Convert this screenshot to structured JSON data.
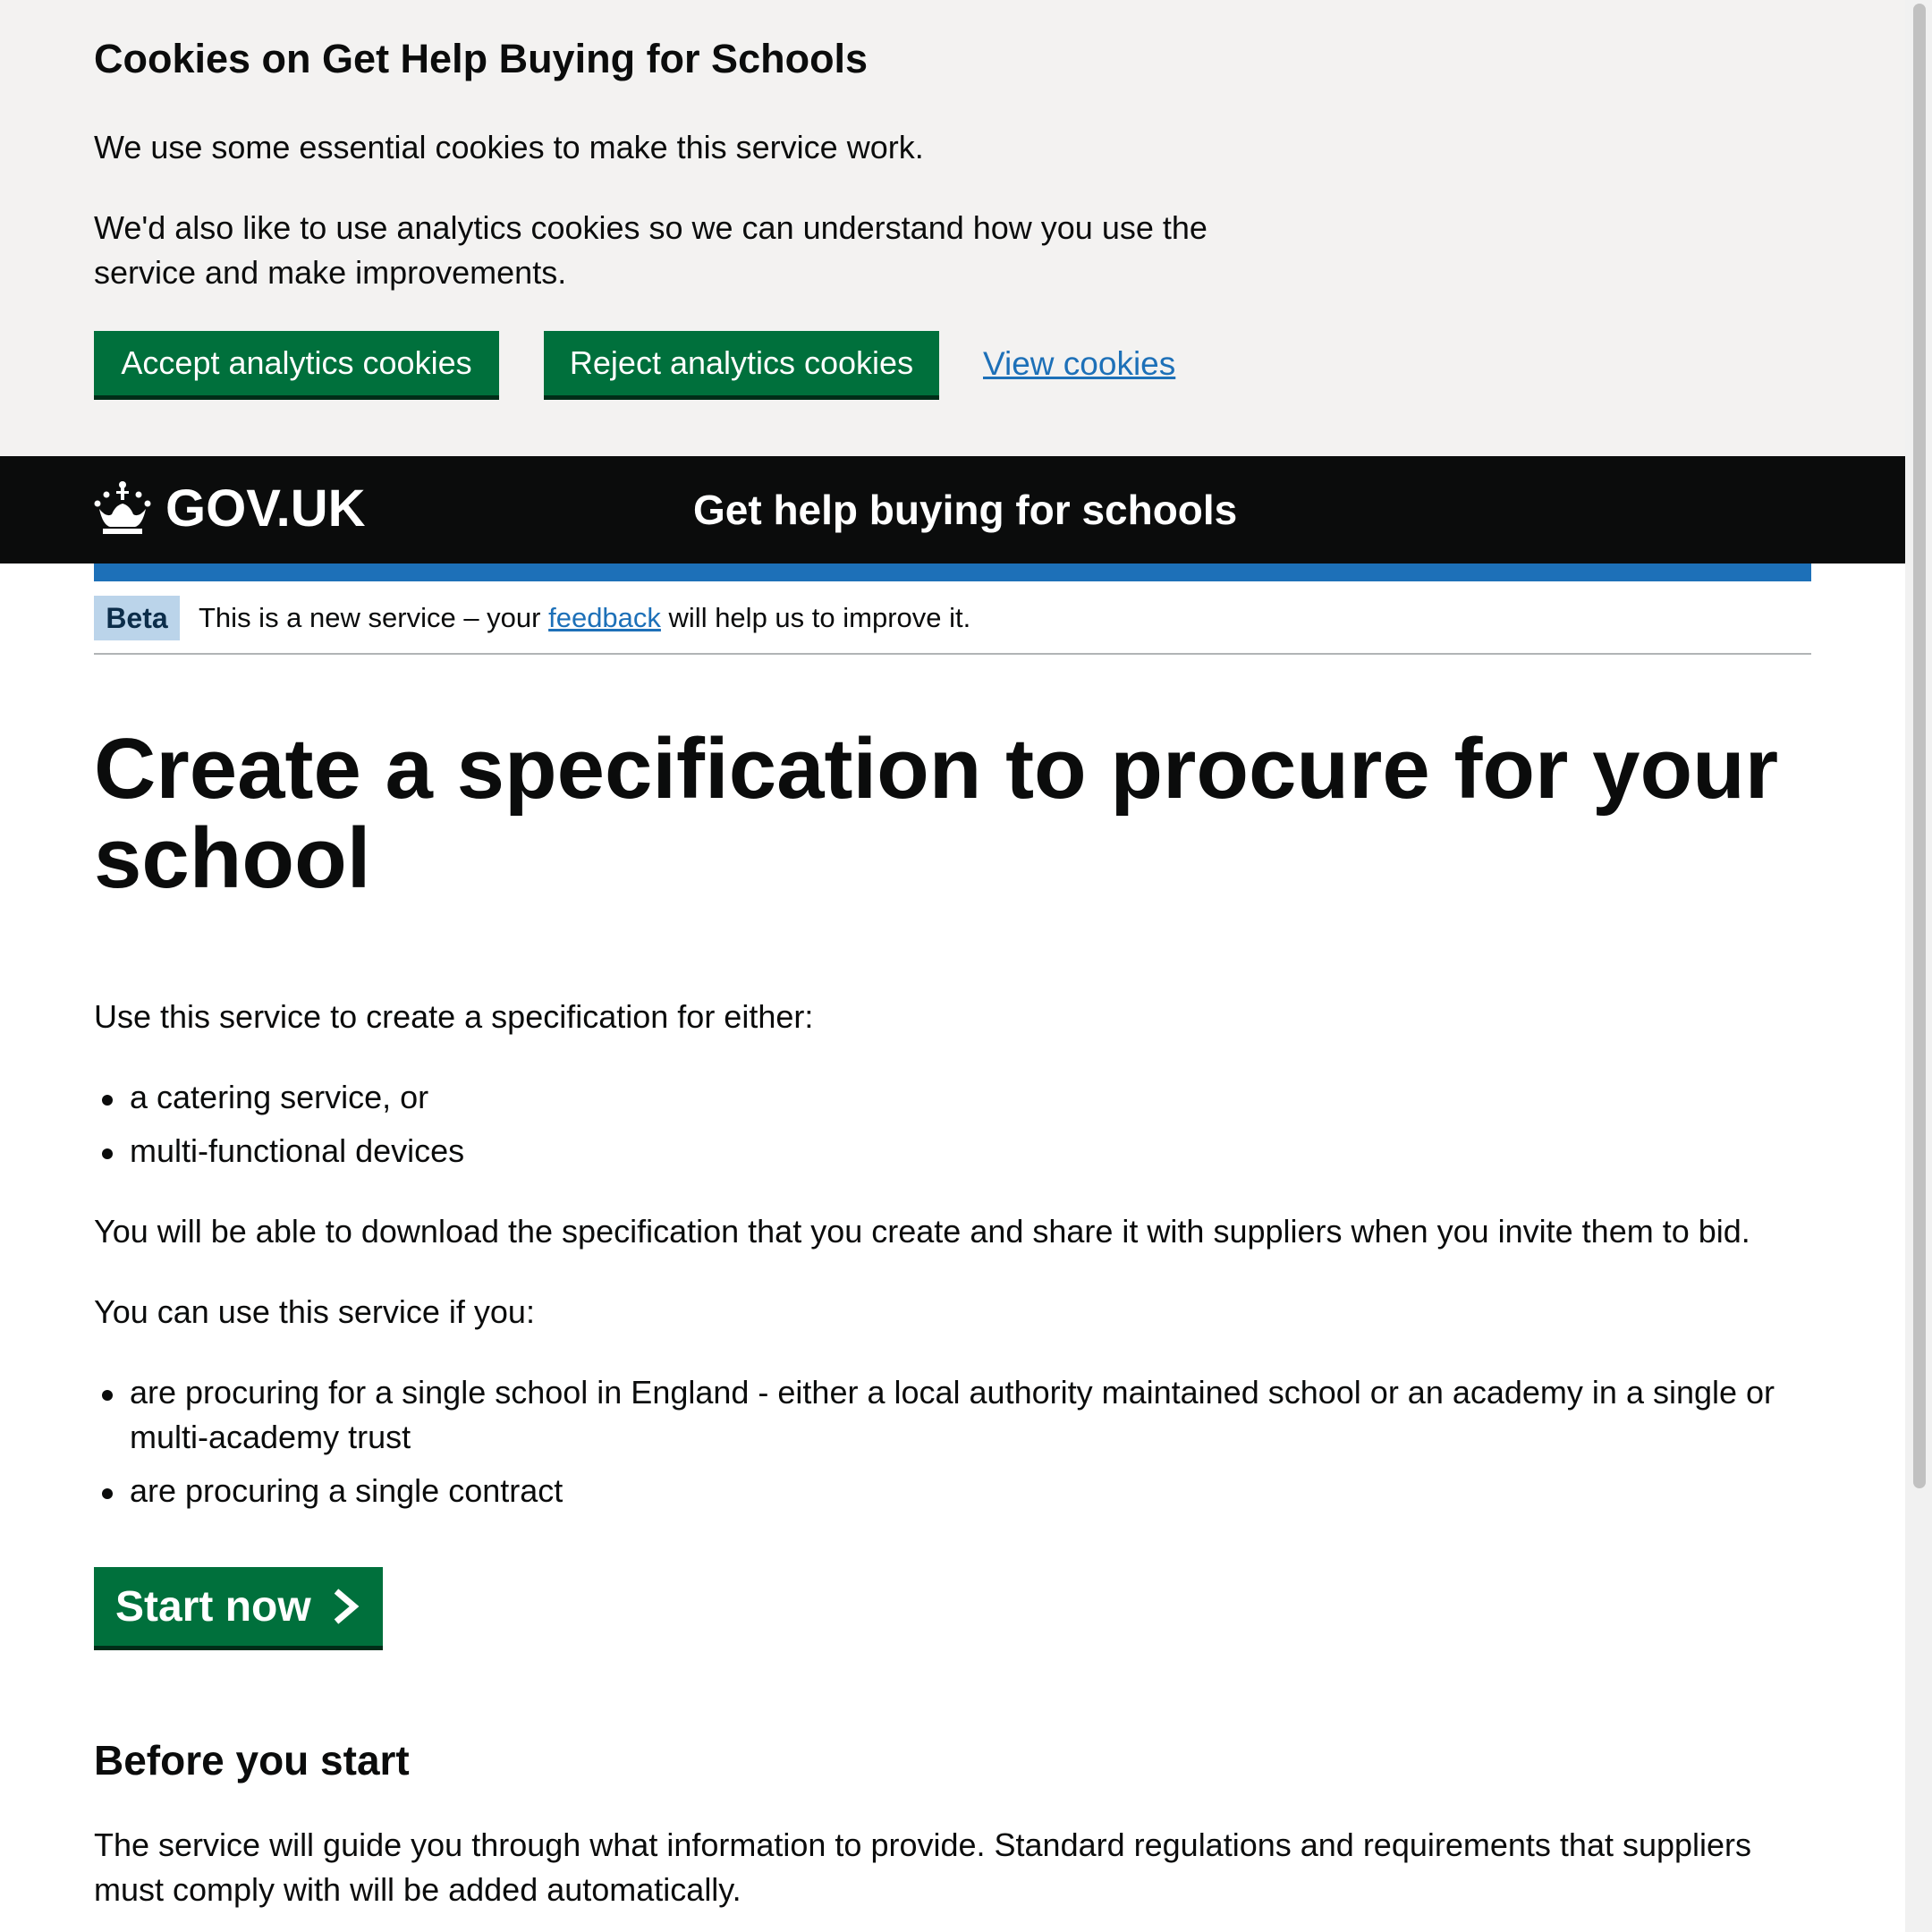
{
  "cookie_banner": {
    "title": "Cookies on Get Help Buying for Schools",
    "p1": "We use some essential cookies to make this service work.",
    "p2": "We'd also like to use analytics cookies so we can understand how you use the service and make improvements.",
    "accept_label": "Accept analytics cookies",
    "reject_label": "Reject analytics cookies",
    "view_label": "View cookies"
  },
  "header": {
    "logo_text": "GOV.UK",
    "logo_icon": "crown-icon",
    "service_name": "Get help buying for schools"
  },
  "phase_banner": {
    "tag": "Beta",
    "text_before": "This is a new service – your ",
    "link": "feedback",
    "text_after": " will help us to improve it."
  },
  "main": {
    "title": "Create a specification to procure for your school",
    "intro": "Use this service to create a specification for either:",
    "options": [
      "a catering service, or",
      "multi-functional devices"
    ],
    "download_text": "You will be able to download the specification that you create and share it with suppliers when you invite them to bid.",
    "eligibility_intro": "You can use this service if you:",
    "eligibility": [
      "are procuring for a single school in England - either a local authority maintained school or an academy in a single or multi-academy trust",
      "are procuring a single contract"
    ],
    "start_label": "Start now",
    "before_heading": "Before you start",
    "before_text": "The service will guide you through what information to provide. Standard regulations and requirements that suppliers must comply with will be added automatically."
  },
  "colors": {
    "green": "#00703c",
    "blue": "#1d70b8",
    "black": "#0b0c0c",
    "banner_bg": "#f3f2f1"
  }
}
